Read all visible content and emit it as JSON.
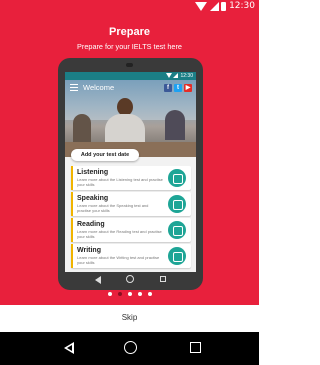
{
  "status_bar": {
    "time": "12:30"
  },
  "header": {
    "title": "Prepare",
    "subtitle": "Prepare for your IELTS test here"
  },
  "mock_app": {
    "status_time": "12:30",
    "appbar_title": "Welcome",
    "social_icons": [
      "facebook-icon",
      "twitter-icon",
      "youtube-icon"
    ],
    "add_date_label": "Add your test date",
    "cards": [
      {
        "title": "Listening",
        "desc": "Learn more about the Listening test and practise your skills",
        "icon": "ear-icon"
      },
      {
        "title": "Speaking",
        "desc": "Learn more about the Speaking test and practise your skills",
        "icon": "speech-icon"
      },
      {
        "title": "Reading",
        "desc": "Learn more about the Reading test and practise your skills",
        "icon": "book-icon"
      },
      {
        "title": "Writing",
        "desc": "Learn more about the Writing test and practise your skills",
        "icon": "pencil-icon"
      }
    ]
  },
  "pager": {
    "total": 5,
    "active_index": 1
  },
  "skip_label": "Skip",
  "colors": {
    "brand": "#e8203c",
    "accent": "#f0b400",
    "teal": "#1ea596"
  }
}
